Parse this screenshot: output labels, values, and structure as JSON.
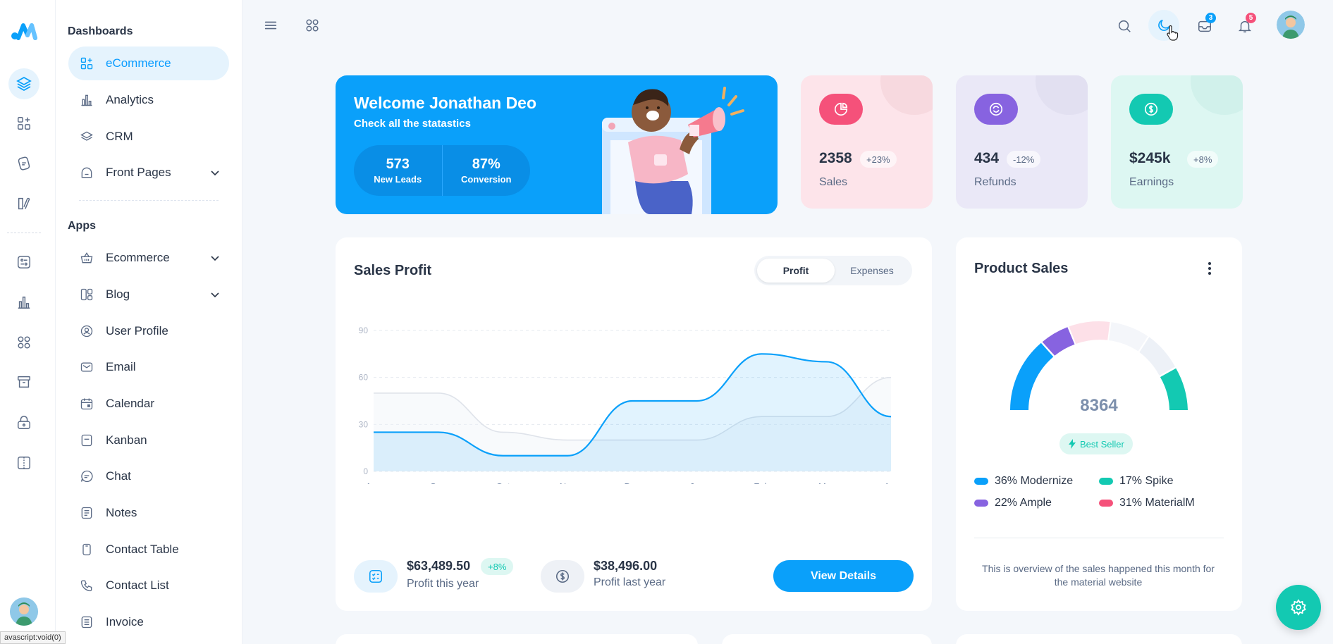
{
  "sidebar": {
    "dashboards_title": "Dashboards",
    "apps_title": "Apps",
    "dashboard_items": [
      {
        "label": "eCommerce",
        "icon": "ecommerce-icon"
      },
      {
        "label": "Analytics",
        "icon": "analytics-icon"
      },
      {
        "label": "CRM",
        "icon": "crm-icon"
      },
      {
        "label": "Front Pages",
        "icon": "front-pages-icon"
      }
    ],
    "app_items": [
      {
        "label": "Ecommerce",
        "icon": "basket-icon"
      },
      {
        "label": "Blog",
        "icon": "blog-icon"
      },
      {
        "label": "User Profile",
        "icon": "user-profile-icon"
      },
      {
        "label": "Email",
        "icon": "email-icon"
      },
      {
        "label": "Calendar",
        "icon": "calendar-icon"
      },
      {
        "label": "Kanban",
        "icon": "kanban-icon"
      },
      {
        "label": "Chat",
        "icon": "chat-icon"
      },
      {
        "label": "Notes",
        "icon": "notes-icon"
      },
      {
        "label": "Contact Table",
        "icon": "contact-table-icon"
      },
      {
        "label": "Contact List",
        "icon": "phone-icon"
      },
      {
        "label": "Invoice",
        "icon": "invoice-icon"
      }
    ]
  },
  "topbar": {
    "mail_badge": "3",
    "notification_badge": "5"
  },
  "welcome": {
    "title": "Welcome Jonathan Deo",
    "subtitle": "Check all the statastics",
    "leads_value": "573",
    "leads_label": "New Leads",
    "conversion_value": "87%",
    "conversion_label": "Conversion"
  },
  "stats": [
    {
      "value": "2358",
      "change": "+23%",
      "label": "Sales",
      "icon": "pie-chart-icon",
      "bg": "#fde4ea",
      "accent": "#f5517a"
    },
    {
      "value": "434",
      "change": "-12%",
      "label": "Refunds",
      "icon": "refresh-icon",
      "bg": "#eae8f7",
      "accent": "#8763e0"
    },
    {
      "value": "$245k",
      "change": "+8%",
      "label": "Earnings",
      "icon": "dollar-icon",
      "bg": "#ddf7f2",
      "accent": "#13c9b2"
    }
  ],
  "sales_profit": {
    "title": "Sales Profit",
    "tab_profit": "Profit",
    "tab_expenses": "Expenses",
    "profit_this_year_amount": "$63,489.50",
    "profit_this_year_change": "+8%",
    "profit_this_year_label": "Profit this year",
    "profit_last_year_amount": "$38,496.00",
    "profit_last_year_label": "Profit last year",
    "view_details": "View Details"
  },
  "chart_data": {
    "type": "area",
    "x": [
      "Aug",
      "Sep",
      "Oct",
      "Nov",
      "Dec",
      "Jan",
      "Feb",
      "Mar",
      "Apr"
    ],
    "yticks": [
      0,
      30,
      60,
      90
    ],
    "ylim": [
      0,
      90
    ],
    "series": [
      {
        "values": [
          25,
          25,
          10,
          10,
          45,
          45,
          75,
          70,
          35
        ],
        "color": "#0aa0fa"
      },
      {
        "values": [
          50,
          50,
          25,
          20,
          20,
          20,
          35,
          35,
          60
        ],
        "color": "#dfe3ea"
      }
    ]
  },
  "product_sales": {
    "title": "Product Sales",
    "total": "8364",
    "badge": "Best Seller",
    "legend": [
      {
        "label": "36% Modernize",
        "color": "#0aa0fa"
      },
      {
        "label": "17% Spike",
        "color": "#13c9b2"
      },
      {
        "label": "22% Ample",
        "color": "#8763e0"
      },
      {
        "label": "31% MaterialM",
        "color": "#f5517a"
      }
    ],
    "description": "This is overview of the sales happened this month for the material website"
  },
  "statusbar_text": "avascript:void(0)"
}
